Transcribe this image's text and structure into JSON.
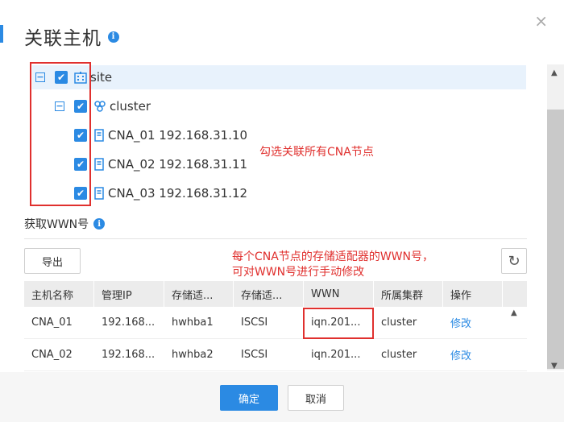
{
  "dialog": {
    "title": "关联主机",
    "close_glyph": "×",
    "info_glyph": "i"
  },
  "tree": {
    "root": {
      "label": "site",
      "toggle": "−",
      "icon": "building-icon"
    },
    "cluster": {
      "label": "cluster",
      "toggle": "−",
      "icon": "cluster-icon"
    },
    "hosts": [
      {
        "label": "CNA_01 192.168.31.10",
        "icon": "server-icon"
      },
      {
        "label": "CNA_02 192.168.31.11",
        "icon": "server-icon"
      },
      {
        "label": "CNA_03 192.168.31.12",
        "icon": "server-icon"
      }
    ]
  },
  "annotations": {
    "select_nodes": "勾选关联所有CNA节点",
    "wwn_line1": "每个CNA节点的存储适配器的WWN号，",
    "wwn_line2": "可对WWN号进行手动修改"
  },
  "wwn_section": {
    "label": "获取WWN号",
    "export_label": "导出",
    "refresh_glyph": "↻"
  },
  "table": {
    "headers": [
      "主机名称",
      "管理IP",
      "存储适...",
      "存储适...",
      "WWN",
      "所属集群",
      "操作"
    ],
    "rows": [
      [
        "CNA_01",
        "192.168...",
        "hwhba1",
        "ISCSI",
        "iqn.201...",
        "cluster",
        "修改"
      ],
      [
        "CNA_02",
        "192.168...",
        "hwhba2",
        "ISCSI",
        "iqn.201...",
        "cluster",
        "修改"
      ]
    ]
  },
  "footer": {
    "ok_label": "确定",
    "cancel_label": "取消"
  },
  "colors": {
    "accent": "#2b8ae3",
    "annotation": "#e0302e"
  }
}
